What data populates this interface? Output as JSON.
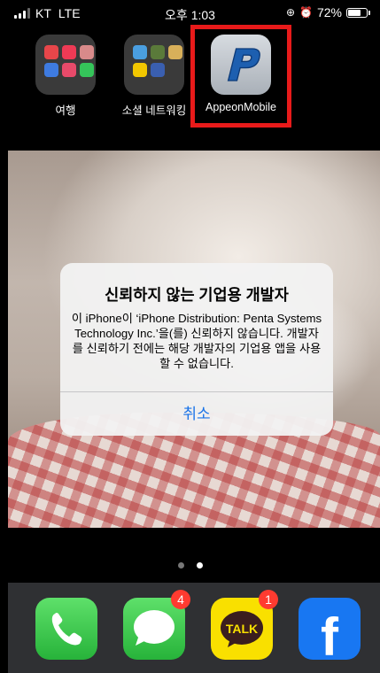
{
  "status_bar": {
    "carrier": "KT",
    "network": "LTE",
    "time": "오후 1:03",
    "battery_percent": "72%",
    "battery_level": 0.72
  },
  "home": {
    "apps": [
      {
        "label": "여행",
        "icon": "travel-folder-icon"
      },
      {
        "label": "소셜 네트워킹",
        "icon": "social-networking-folder-icon"
      },
      {
        "label": "AppeonMobile",
        "icon": "appeon-p-logo-icon"
      }
    ],
    "highlight_color": "#e81a1a"
  },
  "alert": {
    "title": "신뢰하지 않는 기업용 개발자",
    "message": "이 iPhone이 ‘iPhone Distribution: Penta Systems Technology Inc.’을(를) 신뢰하지 않습니다. 개발자를 신뢰하기 전에는 해당 개발자의 기업용 앱을 사용할 수 없습니다.",
    "button": "취소",
    "button_color": "#1a73e8"
  },
  "page_indicator": {
    "pages": 2,
    "current": 2
  },
  "dock": {
    "apps": [
      {
        "name": "Phone",
        "icon": "phone-icon"
      },
      {
        "name": "Messages",
        "icon": "messages-icon",
        "badge": "4"
      },
      {
        "name": "KakaoTalk",
        "icon": "kakaotalk-icon",
        "badge": "1",
        "text": "TALK"
      },
      {
        "name": "Facebook",
        "icon": "facebook-icon",
        "text": "f"
      }
    ]
  }
}
